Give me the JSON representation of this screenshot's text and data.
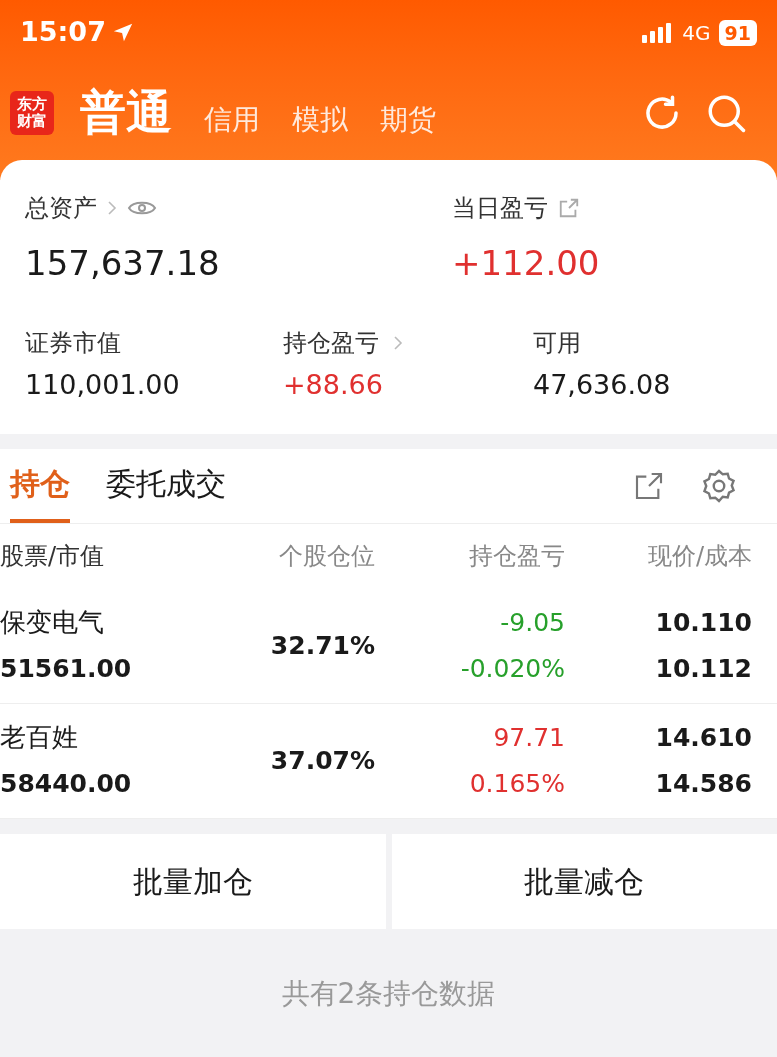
{
  "status_bar": {
    "time": "15:07",
    "network": "4G",
    "battery": "91"
  },
  "header": {
    "logo": "东方财富",
    "tabs": [
      {
        "label": "普通",
        "selected": true
      },
      {
        "label": "信用",
        "selected": false
      },
      {
        "label": "模拟",
        "selected": false
      },
      {
        "label": "期货",
        "selected": false
      }
    ]
  },
  "summary": {
    "headline": [
      {
        "kind": "assets",
        "label": "总资产",
        "value": "157,637.18",
        "color": "#1a1a1a"
      },
      {
        "kind": "daily",
        "label": "当日盈亏",
        "value": "+112.00",
        "color": "#e0302f"
      }
    ],
    "stats": [
      {
        "label": "证券市值",
        "value": "110,001.00",
        "color": "#1a1a1a",
        "link": false
      },
      {
        "label": "持仓盈亏",
        "value": "+88.66",
        "color": "#e0302f",
        "link": true
      },
      {
        "label": "可用",
        "value": "47,636.08",
        "color": "#1a1a1a",
        "link": false
      }
    ]
  },
  "position_tabs": [
    {
      "label": "持仓",
      "selected": true
    },
    {
      "label": "委托成交",
      "selected": false
    }
  ],
  "table": {
    "columns": [
      "股票/市值",
      "个股仓位",
      "持仓盈亏",
      "现价/成本"
    ],
    "rows": [
      {
        "name": "保变电气",
        "market_value": "51561.00",
        "weight": "32.71%",
        "pl": "-9.05",
        "pl_pct": "-0.020%",
        "color": "#27a02b",
        "price": "10.110",
        "cost": "10.112"
      },
      {
        "name": "老百姓",
        "market_value": "58440.00",
        "weight": "37.07%",
        "pl": "97.71",
        "pl_pct": "0.165%",
        "color": "#e0302f",
        "price": "14.610",
        "cost": "14.586"
      }
    ]
  },
  "actions": [
    "批量加仓",
    "批量减仓"
  ],
  "footer": "共有2条持仓数据"
}
